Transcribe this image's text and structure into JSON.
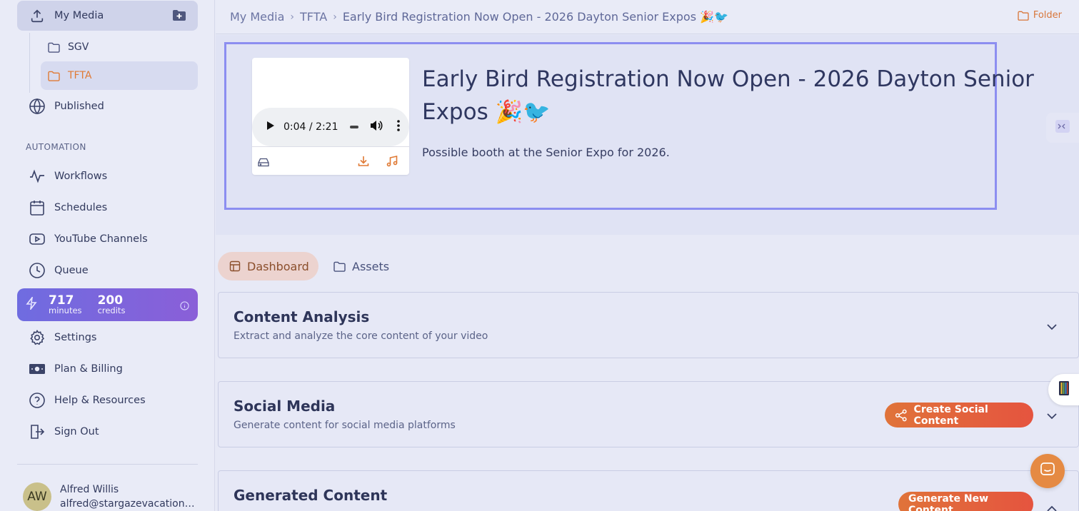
{
  "sidebar": {
    "my_media": "My Media",
    "folders": [
      {
        "label": "SGV"
      },
      {
        "label": "TFTA"
      }
    ],
    "published": "Published",
    "automation_label": "AUTOMATION",
    "automation_items": [
      {
        "label": "Workflows"
      },
      {
        "label": "Schedules"
      },
      {
        "label": "YouTube Channels"
      },
      {
        "label": "Queue"
      }
    ],
    "credits": {
      "minutes_value": "717",
      "minutes_unit": "minutes",
      "credits_value": "200",
      "credits_unit": "credits"
    },
    "bottom_items": [
      {
        "label": "Settings"
      },
      {
        "label": "Plan & Billing"
      },
      {
        "label": "Help & Resources"
      },
      {
        "label": "Sign Out"
      }
    ],
    "user": {
      "initials": "AW",
      "name": "Alfred Willis",
      "email": "alfred@stargazevacations.c..."
    }
  },
  "topbar": {
    "breadcrumb": [
      "My Media",
      "TFTA",
      "Early Bird Registration Now Open - 2026 Dayton Senior Expos 🎉🐦"
    ],
    "folder_button": "Folder"
  },
  "media": {
    "title": "Early Bird Registration Now Open - 2026 Dayton Senior Expos 🎉🐦",
    "description": "Possible booth at the Senior Expo for 2026.",
    "player": {
      "time": "0:04 / 2:21"
    }
  },
  "tabs": [
    {
      "label": "Dashboard"
    },
    {
      "label": "Assets"
    }
  ],
  "panels": {
    "content_analysis": {
      "title": "Content Analysis",
      "subtitle": "Extract and analyze the core content of your video"
    },
    "social_media": {
      "title": "Social Media",
      "subtitle": "Generate content for social media platforms",
      "action": "Create Social Content"
    },
    "generated_content": {
      "title": "Generated Content",
      "action": "Generate New Content"
    }
  },
  "colors": {
    "accent": "#e07a35",
    "credits_gradient_start": "#6f6ce0",
    "credits_gradient_end": "#8a5fd8",
    "selection": "#8c8ef0"
  }
}
